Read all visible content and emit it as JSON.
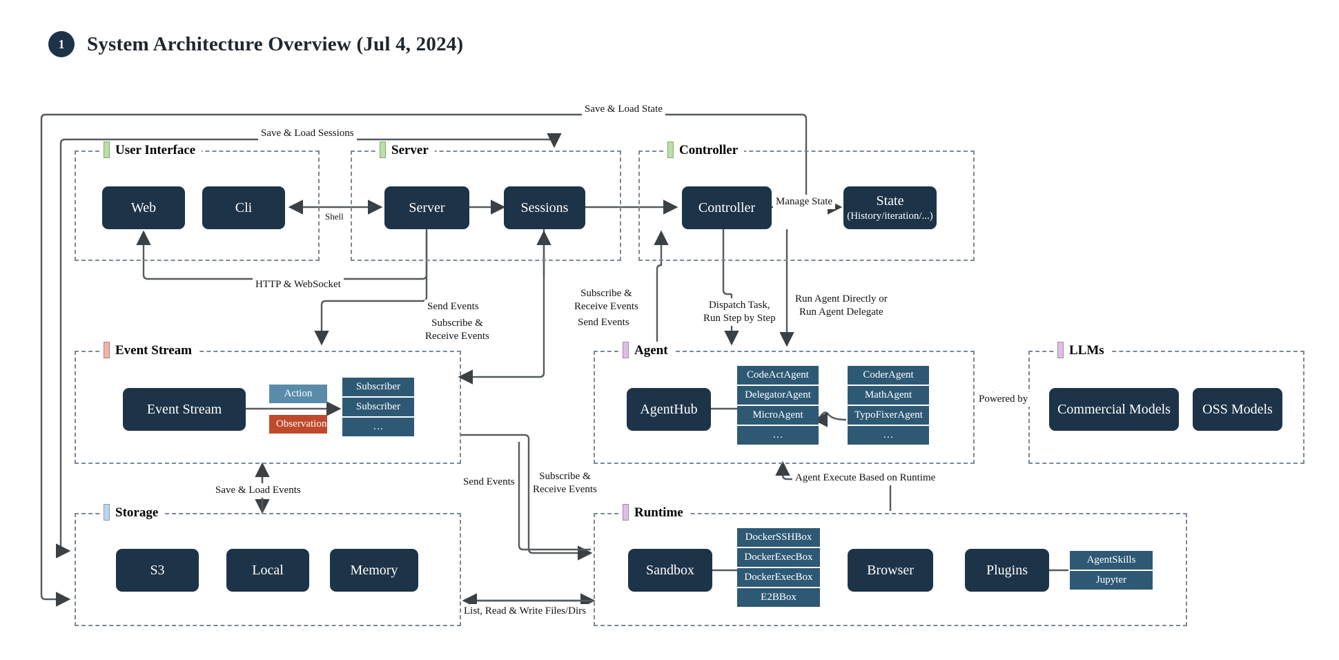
{
  "header": {
    "badge": "1",
    "title": "System Architecture Overview (Jul 4, 2024)"
  },
  "groups": {
    "user_interface": {
      "label": "User Interface",
      "bar_color": "#b9e0a5"
    },
    "server": {
      "label": "Server",
      "bar_color": "#b9e0a5"
    },
    "controller": {
      "label": "Controller",
      "bar_color": "#b9e0a5"
    },
    "event_stream": {
      "label": "Event Stream",
      "bar_color": "#f3b0ad"
    },
    "agent": {
      "label": "Agent",
      "bar_color": "#ddbfe4"
    },
    "llms": {
      "label": "LLMs",
      "bar_color": "#ddbfe4"
    },
    "storage": {
      "label": "Storage",
      "bar_color": "#bcd6ef"
    },
    "runtime": {
      "label": "Runtime",
      "bar_color": "#ddbfe4"
    }
  },
  "nodes": {
    "web": "Web",
    "cli": "Cli",
    "server": "Server",
    "sessions": "Sessions",
    "controller": "Controller",
    "state": "State",
    "state_sub": "(History/iteration/...)",
    "event_stream": "Event Stream",
    "agent_hub": "AgentHub",
    "commercial_models": "Commercial Models",
    "oss_models": "OSS Models",
    "s3": "S3",
    "local": "Local",
    "memory": "Memory",
    "sandbox": "Sandbox",
    "browser": "Browser",
    "plugins": "Plugins"
  },
  "event_stream_tags": {
    "action": "Action",
    "observation": "Observation"
  },
  "subscribers": [
    "Subscriber",
    "Subscriber",
    "…"
  ],
  "agent_list_left": [
    "CodeActAgent",
    "DelegatorAgent",
    "MicroAgent",
    "…"
  ],
  "agent_list_right": [
    "CoderAgent",
    "MathAgent",
    "TypoFixerAgent",
    "…"
  ],
  "sandbox_list": [
    "DockerSSHBox",
    "DockerExecBox",
    "DockerExecBox",
    "E2BBox"
  ],
  "plugin_list": [
    "AgentSkills",
    "Jupyter"
  ],
  "edge_labels": {
    "save_load_state": "Save & Load State",
    "save_load_sessions": "Save & Load Sessions",
    "shell": "Shell",
    "manage_state": "Manage State",
    "http_websocket": "HTTP & WebSocket",
    "send_events_1": "Send Events",
    "subscribe_receive_1": "Subscribe &\nReceive Events",
    "subscribe_receive_2": "Subscribe &\nReceive Events",
    "send_events_2": "Send Events",
    "dispatch_task": "Dispatch Task,\nRun Step by Step",
    "run_agent": "Run Agent Directly or\nRun Agent Delegate",
    "powered_by": "Powered by",
    "save_load_events": "Save & Load Events",
    "send_events_3": "Send Events",
    "subscribe_receive_3": "Subscribe &\nReceive Events",
    "agent_execute": "Agent Execute Based on Runtime",
    "list_read_write": "List, Read & Write Files/Dirs"
  },
  "colors": {
    "node_fill": "#1d3348",
    "chip_fill": "#2e5975",
    "action_fill": "#5a8caa",
    "observation_fill": "#c0492a",
    "group_border": "#7b8794",
    "wire": "#555a5e"
  }
}
